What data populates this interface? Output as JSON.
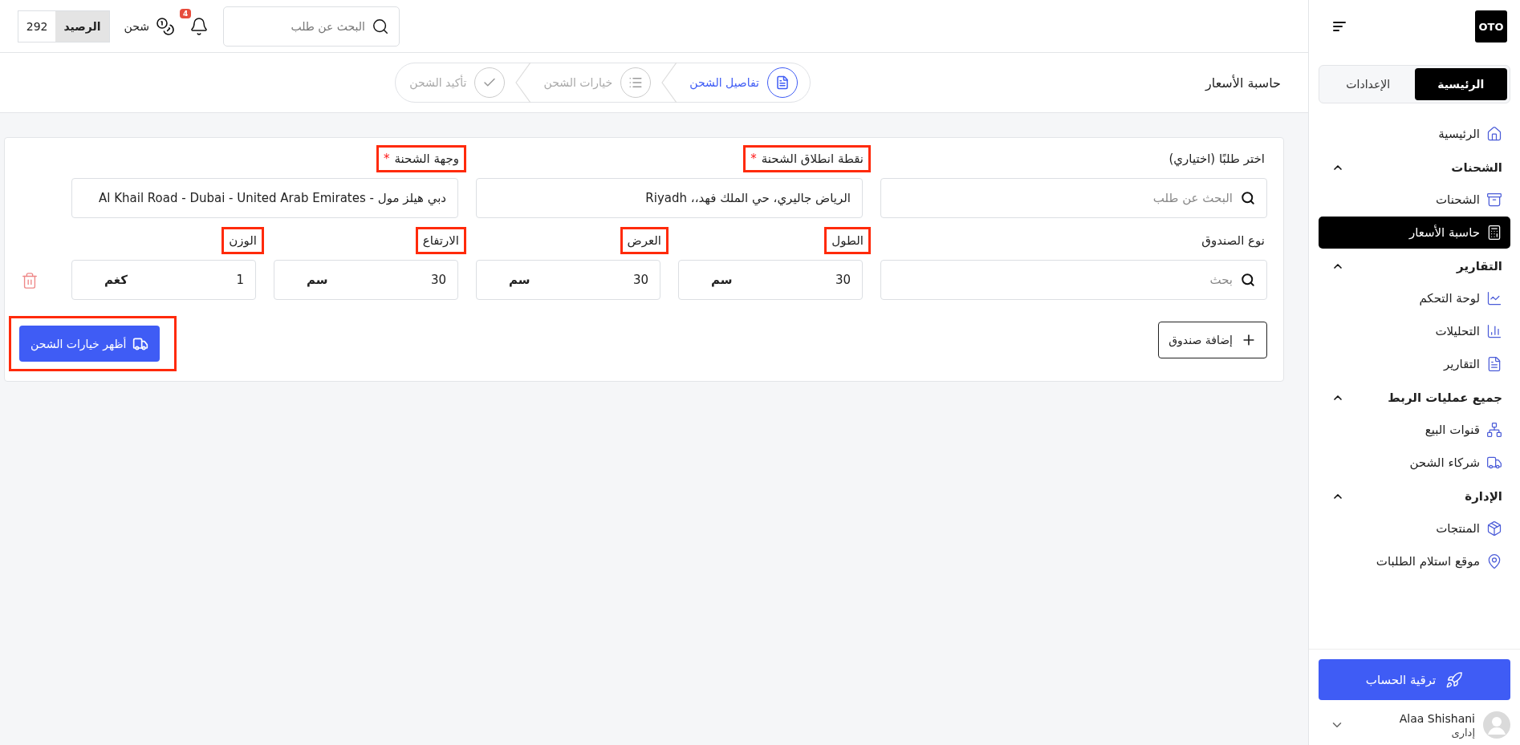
{
  "top_bar": {
    "search": {
      "placeholder": "البحث عن طلب"
    },
    "notifications_badge": "4",
    "shipping_label": "شحن",
    "balance": {
      "label": "الرصيد",
      "value": "292"
    }
  },
  "page_title": "حاسبة الأسعار",
  "steps": [
    {
      "label": "تفاصيل الشحن",
      "selected": true
    },
    {
      "label": "خيارات الشحن",
      "selected": false
    },
    {
      "label": "تأكيد الشحن",
      "selected": false
    }
  ],
  "form": {
    "row_1": [
      {
        "kind": "search",
        "label": "اختر طلبًا (اختياري)",
        "highlighted": false,
        "placeholder": "البحث عن طلب"
      },
      {
        "kind": "text",
        "label": "نقطة انطلاق الشحنة",
        "required_mark": "*",
        "highlighted": true,
        "value": "الرياض جاليري، حي الملك فهد،، Riyadh"
      },
      {
        "kind": "text",
        "label": "وجهة الشحنة",
        "required_mark": "*",
        "highlighted": true,
        "value": "دبي هيلز مول - Al Khail Road - Dubai - United Arab Emirates"
      }
    ],
    "row_2": [
      {
        "kind": "search",
        "label": "نوع الصندوق",
        "highlighted": false,
        "placeholder": "بحث"
      },
      {
        "kind": "measure",
        "label": "الطول",
        "highlighted": true,
        "value": "30",
        "unit": "سم"
      },
      {
        "kind": "measure",
        "label": "العرض",
        "highlighted": true,
        "value": "30",
        "unit": "سم"
      },
      {
        "kind": "measure",
        "label": "الارتفاع",
        "highlighted": true,
        "value": "30",
        "unit": "سم"
      },
      {
        "kind": "measure",
        "label": "الوزن",
        "highlighted": true,
        "value": "1",
        "unit": "كغم"
      }
    ],
    "add_box_button": "إضافة صندوق",
    "show_options_button": {
      "label": "أظهر خيارات الشحن",
      "highlighted": true
    }
  },
  "sidebar": {
    "logo": "OTO",
    "tabs": [
      {
        "label": "الرئيسية",
        "selected": true
      },
      {
        "label": "الإعدادات",
        "selected": false
      }
    ],
    "nav": [
      {
        "kind": "item",
        "label": "الرئيسية",
        "selected": false
      },
      {
        "kind": "section",
        "label": "الشحنات",
        "expanded": true,
        "children": [
          {
            "label": "الشحنات",
            "selected": false
          },
          {
            "label": "حاسبة الأسعار",
            "selected": true
          }
        ]
      },
      {
        "kind": "section",
        "label": "التقارير",
        "expanded": true,
        "children": [
          {
            "label": "لوحة التحكم",
            "selected": false
          },
          {
            "label": "التحليلات",
            "selected": false
          },
          {
            "label": "التقارير",
            "selected": false
          }
        ]
      },
      {
        "kind": "section",
        "label": "جميع عمليات الربط",
        "expanded": true,
        "children": [
          {
            "label": "قنوات البيع",
            "selected": false
          },
          {
            "label": "شركاء الشحن",
            "selected": false
          }
        ]
      },
      {
        "kind": "section",
        "label": "الإدارة",
        "expanded": true,
        "children": [
          {
            "label": "المنتجات",
            "selected": false
          },
          {
            "label": "موقع استلام الطلبات",
            "selected": false
          }
        ]
      }
    ],
    "upgrade_button": "ترقية الحساب",
    "user": {
      "name": "Alaa Shishani",
      "role": "إدارى"
    }
  }
}
